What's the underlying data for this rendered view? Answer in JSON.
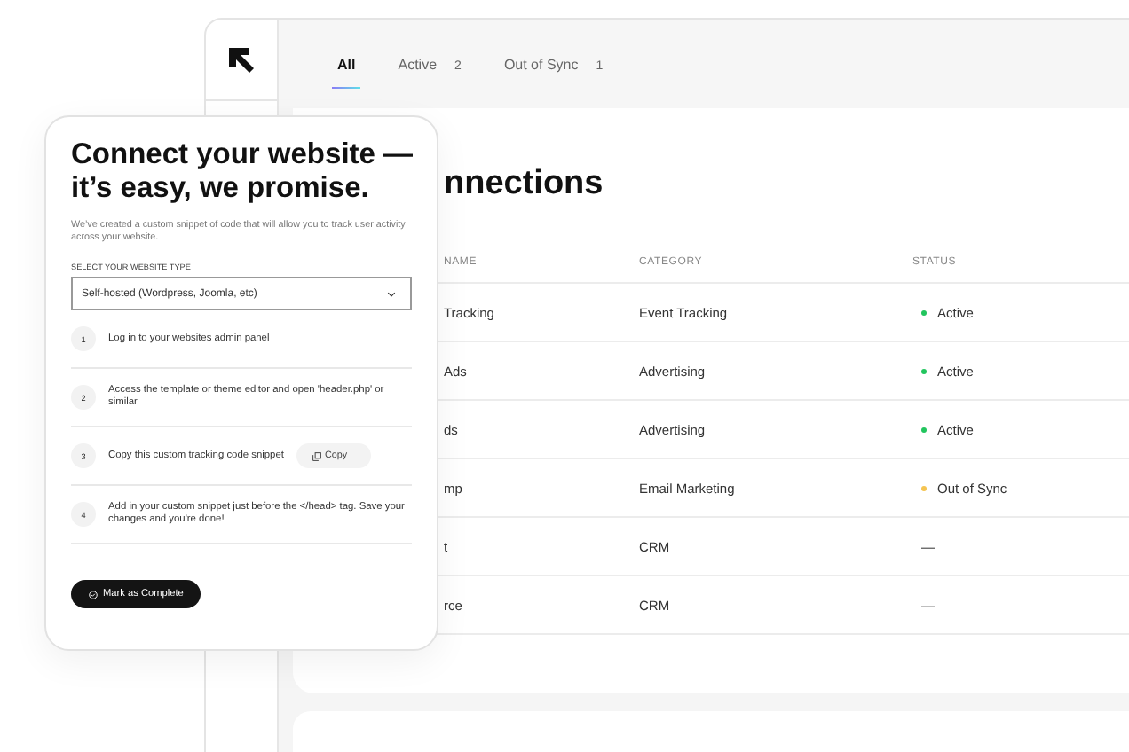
{
  "tabs": [
    {
      "label": "All",
      "selected": true
    },
    {
      "label": "Active",
      "count": "2",
      "selected": false
    },
    {
      "label": "Out of Sync",
      "count": "1",
      "selected": false
    }
  ],
  "page_title": "nnections",
  "table": {
    "columns": [
      "NAME",
      "CATEGORY",
      "STATUS"
    ],
    "rows": [
      {
        "name": "Tracking",
        "category": "Event Tracking",
        "status": "Active",
        "color": "#22c55e"
      },
      {
        "name": "Ads",
        "category": "Advertising",
        "status": "Active",
        "color": "#22c55e"
      },
      {
        "name": "ds",
        "category": "Advertising",
        "status": "Active",
        "color": "#22c55e"
      },
      {
        "name": "mp",
        "category": "Email Marketing",
        "status": "Out of Sync",
        "color": "#f5c451"
      },
      {
        "name": "t",
        "category": "CRM",
        "status": "—"
      },
      {
        "name": "rce",
        "category": "CRM",
        "status": "—"
      }
    ]
  },
  "dialog": {
    "title": "Connect your website — it’s easy, we promise.",
    "description": "We’ve created a custom snippet of code that will allow you to track user activity across your website.",
    "select_label": "SELECT YOUR WEBSITE TYPE",
    "select_value": "Self-hosted (Wordpress, Joomla, etc)",
    "steps": [
      {
        "number": "1",
        "text": "Log in to your websites admin panel",
        "kind": "text"
      },
      {
        "number": "2",
        "text": "Access the template or theme editor and open 'header.php' or similar",
        "kind": "text"
      },
      {
        "number": "3",
        "text": "Copy this custom tracking code snippet",
        "kind": "copy",
        "button": "Copy"
      },
      {
        "number": "4",
        "text": "Add in your custom snippet just before the </head> tag. Save your changes and you're done!",
        "kind": "text"
      }
    ],
    "complete_button": "Mark as Complete"
  }
}
